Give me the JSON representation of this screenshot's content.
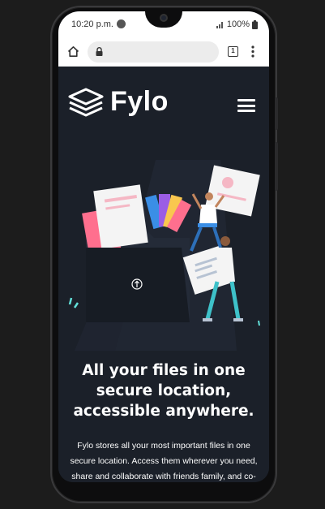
{
  "status_bar": {
    "time": "10:20 p.m.",
    "battery": "100%"
  },
  "browser": {
    "tab_count": "1"
  },
  "site": {
    "logo": "Fylo",
    "headline": "All your files in one secure location, accessible anywhere.",
    "intro": "Fylo stores all your most important files in one secure location. Access them wherever you need, share and collaborate with friends family, and co-"
  },
  "colors": {
    "page_background": "#1b2029",
    "accent_cyan": "#62e0d9",
    "accent_blue": "#3a8ee6",
    "accent_pink": "#ff6f8e"
  }
}
